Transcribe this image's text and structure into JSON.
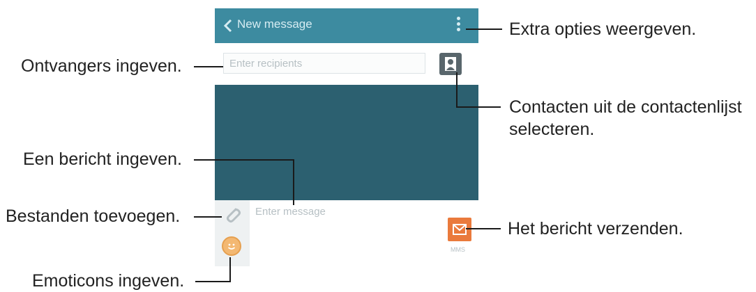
{
  "app": {
    "title": "New message",
    "recipients_placeholder": "Enter recipients",
    "message_placeholder": "Enter message",
    "send_sublabel": "MMS"
  },
  "callouts": {
    "more_options": "Extra opties weergeven.",
    "recipients": "Ontvangers ingeven.",
    "contacts_line1": "Contacten uit de contactenlijst",
    "contacts_line2": "selecteren.",
    "message": "Een bericht ingeven.",
    "attach": "Bestanden toevoegen.",
    "send": "Het bericht verzenden.",
    "emoticons": "Emoticons ingeven."
  },
  "icons": {
    "back": "chevron-left-icon",
    "more": "more-vertical-icon",
    "contact": "contact-icon",
    "attach": "paperclip-icon",
    "emoticon": "smiley-icon",
    "send": "send-icon"
  },
  "colors": {
    "appbar": "#3d8ba0",
    "background": "#2c6070",
    "send_button": "#ea7a3c"
  }
}
